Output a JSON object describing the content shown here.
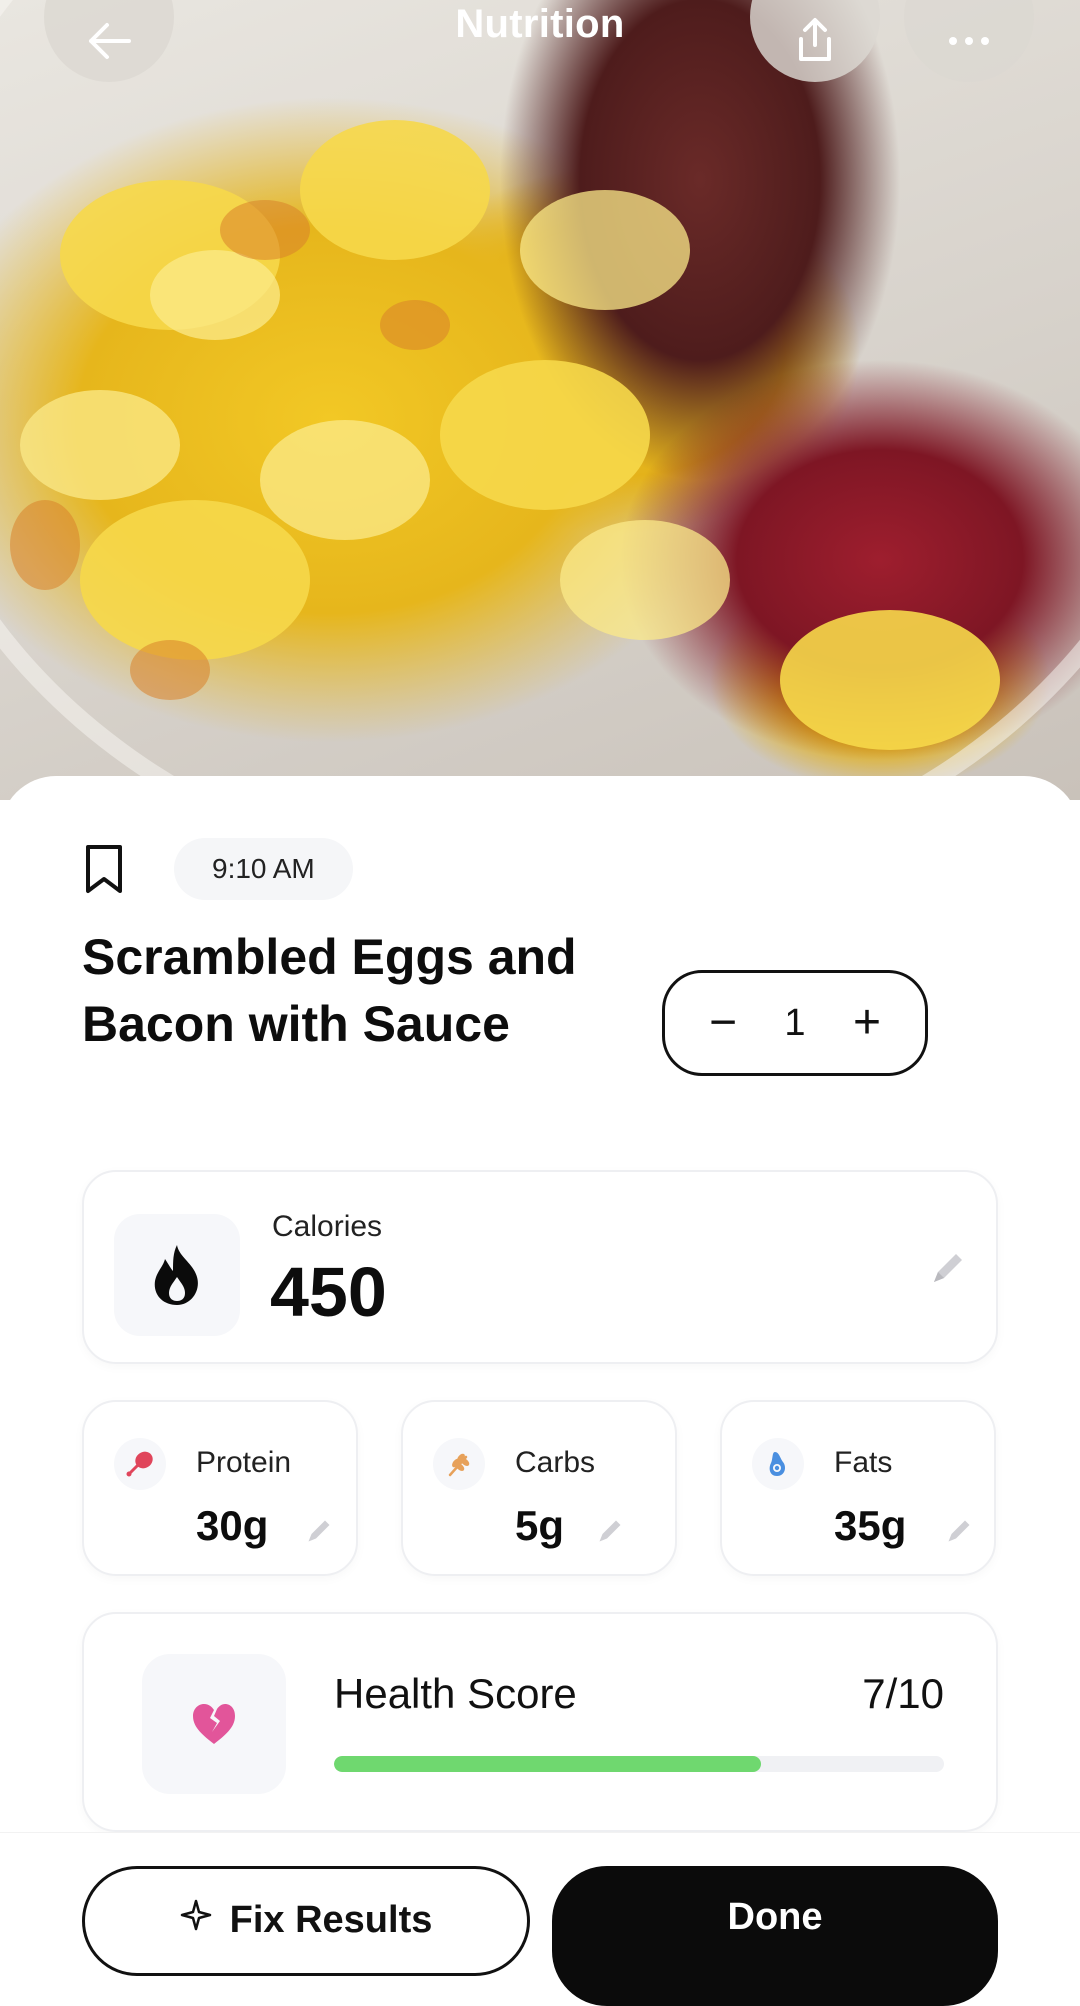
{
  "header": {
    "title": "Nutrition",
    "back_icon": "arrow-left-icon",
    "share_icon": "share-icon",
    "more_icon": "more-horizontal-icon"
  },
  "food": {
    "time": "9:10 AM",
    "name": "Scrambled Eggs and Bacon with Sauce",
    "quantity": "1",
    "decrement_symbol": "−",
    "increment_symbol": "+"
  },
  "calories": {
    "label": "Calories",
    "value": "450"
  },
  "macros": [
    {
      "label": "Protein",
      "value": "30g",
      "icon": "drumstick-icon",
      "color": "#e0455b"
    },
    {
      "label": "Carbs",
      "value": "5g",
      "icon": "wheat-icon",
      "color": "#e7a15a"
    },
    {
      "label": "Fats",
      "value": "35g",
      "icon": "avocado-icon",
      "color": "#4a8fe0"
    }
  ],
  "health": {
    "label": "Health Score",
    "value": "7/10",
    "score_fraction": 0.7,
    "color": "#6fd86f",
    "icon": "broken-heart-icon"
  },
  "actions": {
    "fix_label": "Fix Results",
    "done_label": "Done"
  }
}
